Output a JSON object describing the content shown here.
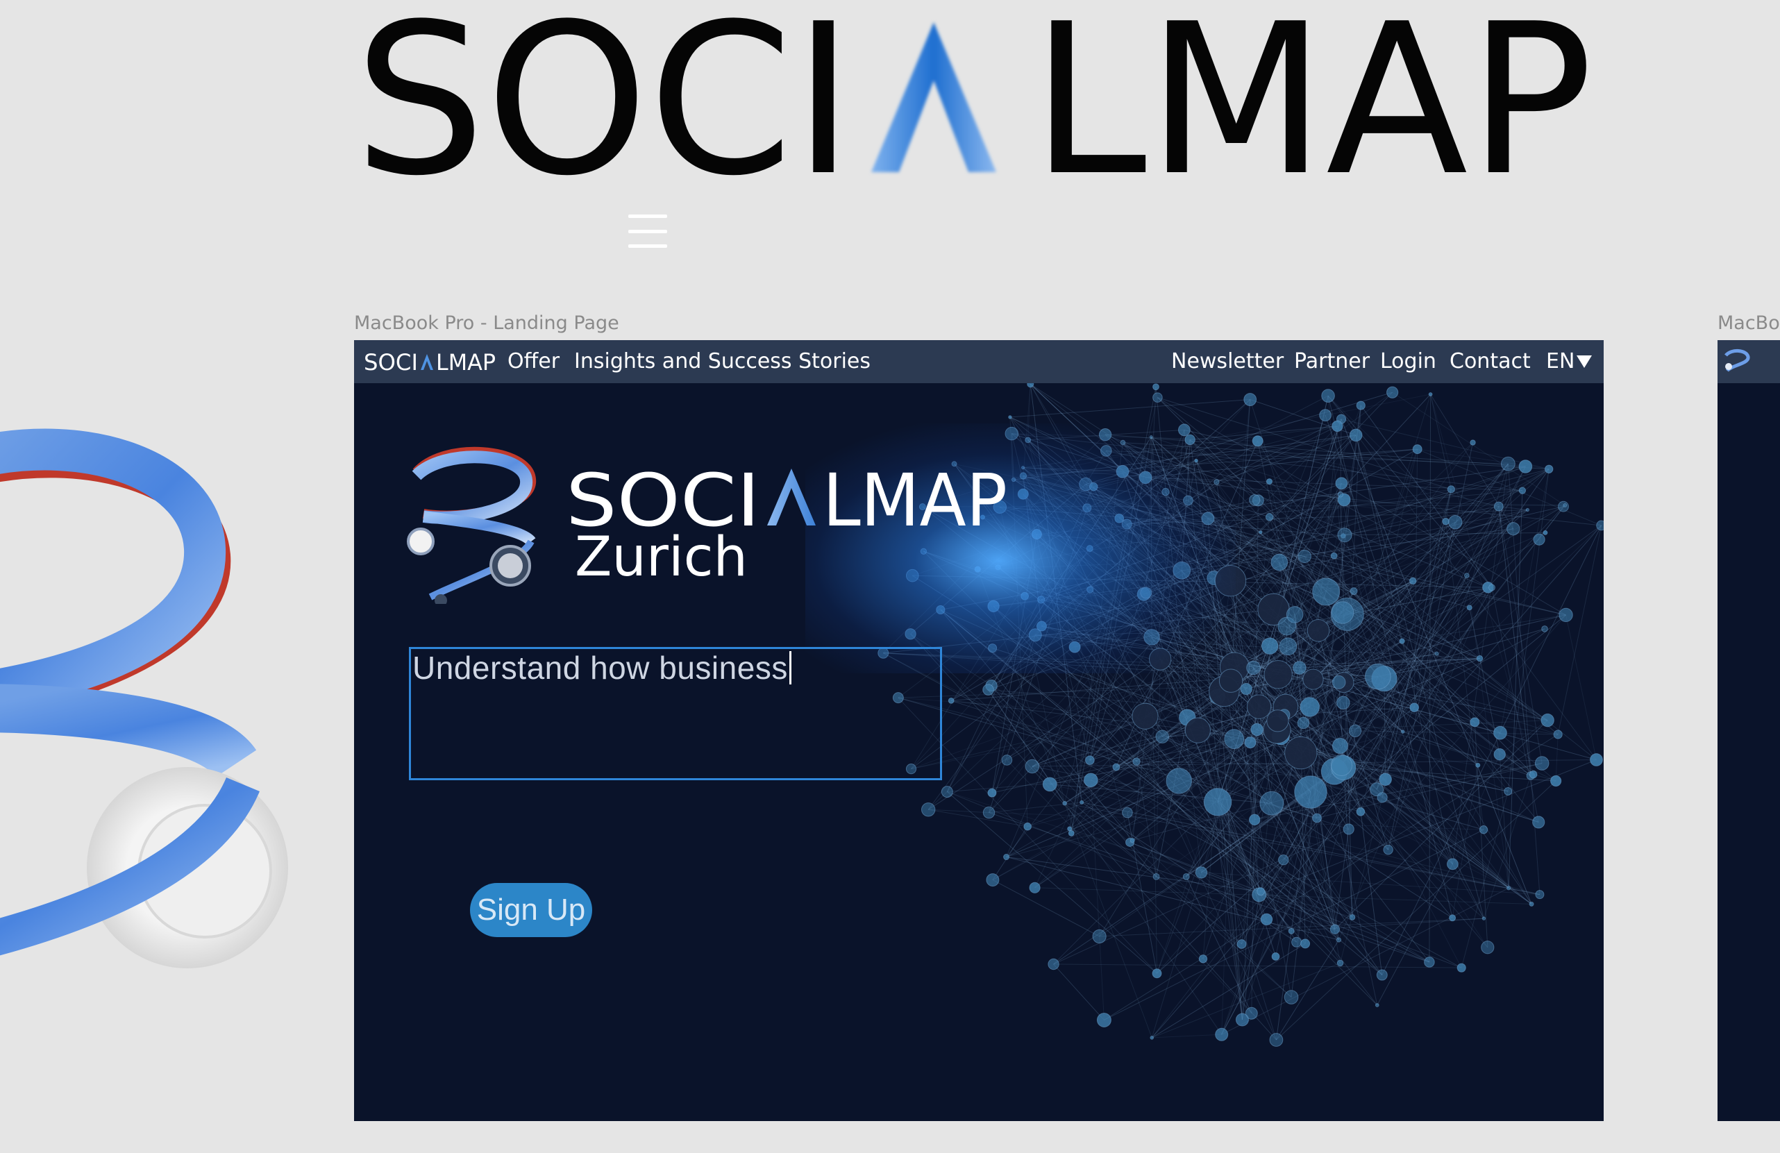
{
  "canvas": {
    "logo_text_1": "SOCI",
    "logo_text_2": "LMAP",
    "frame_label_main": "MacBook Pro - Landing Page",
    "frame_label_right": "MacBo"
  },
  "navbar": {
    "logo_text_1": "SOCI",
    "logo_text_2": "LMAP",
    "links_left": [
      "Offer",
      "Insights and Success Stories"
    ],
    "links_right": [
      "Newsletter",
      "Partner",
      "Login",
      "Contact"
    ],
    "language": "EN"
  },
  "hero": {
    "wordmark_1": "SOCI",
    "wordmark_2": "LMAP",
    "city": "Zurich",
    "tagline": "Understand how business",
    "signup_label": "Sign Up"
  },
  "colors": {
    "background": "#e5e5e5",
    "artboard_bg": "#0a132a",
    "navbar_bg": "#2c3a52",
    "accent_blue": "#2c86c8",
    "input_border": "#2f86d8",
    "logo_blue": "#2f7fd6"
  },
  "icons": {
    "menu": "hamburger-icon",
    "language_dropdown": "triangle-down-icon",
    "brand_symbol": "ribbon-logo-icon"
  }
}
